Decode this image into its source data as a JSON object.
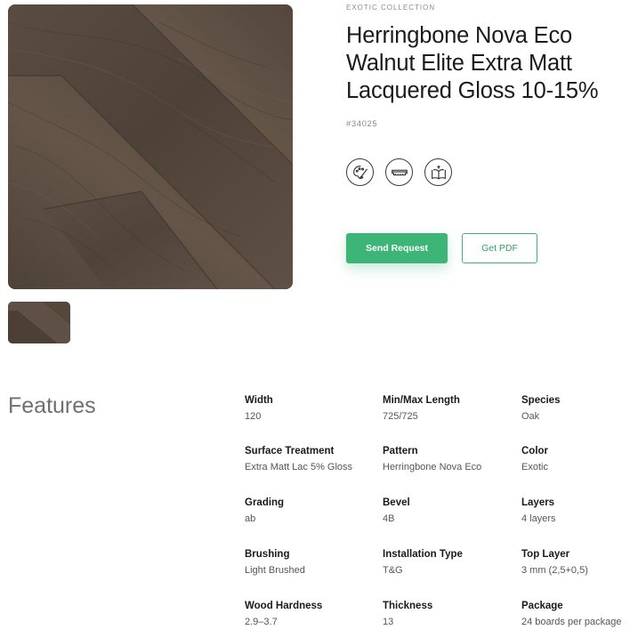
{
  "product": {
    "collection": "EXOTIC COLLECTION",
    "title": "Herringbone Nova Eco Walnut Elite Extra Matt Lacquered Gloss 10-15%",
    "sku": "#34025",
    "image_alt": "Herringbone walnut wood floor",
    "thumbnail_alt": "Herringbone walnut wood floor thumbnail"
  },
  "feature_icons": [
    {
      "name": "palette-brush-icon"
    },
    {
      "name": "plank-profile-icon"
    },
    {
      "name": "open-book-icon"
    }
  ],
  "actions": {
    "send_request": "Send Request",
    "get_pdf": "Get PDF"
  },
  "colors": {
    "accent": "#3cb576",
    "wood_dark": "#4a3d33",
    "wood_light": "#6e5f52"
  },
  "features": {
    "heading": "Features",
    "items": [
      {
        "label": "Width",
        "value": "120"
      },
      {
        "label": "Min/Max Length",
        "value": "725/725"
      },
      {
        "label": "Species",
        "value": "Oak"
      },
      {
        "label": "Surface Treatment",
        "value": "Extra Matt Lac 5% Gloss"
      },
      {
        "label": "Pattern",
        "value": "Herringbone Nova Eco"
      },
      {
        "label": "Color",
        "value": "Exotic"
      },
      {
        "label": "Grading",
        "value": "ab"
      },
      {
        "label": "Bevel",
        "value": "4B"
      },
      {
        "label": "Layers",
        "value": "4 layers"
      },
      {
        "label": "Brushing",
        "value": "Light Brushed"
      },
      {
        "label": "Installation Type",
        "value": "T&G"
      },
      {
        "label": "Top Layer",
        "value": "3 mm (2,5+0,5)"
      },
      {
        "label": "Wood Hardness",
        "value": "2.9–3.7"
      },
      {
        "label": "Thickness",
        "value": "13"
      },
      {
        "label": "Package",
        "value": "24 boards per package"
      }
    ]
  }
}
